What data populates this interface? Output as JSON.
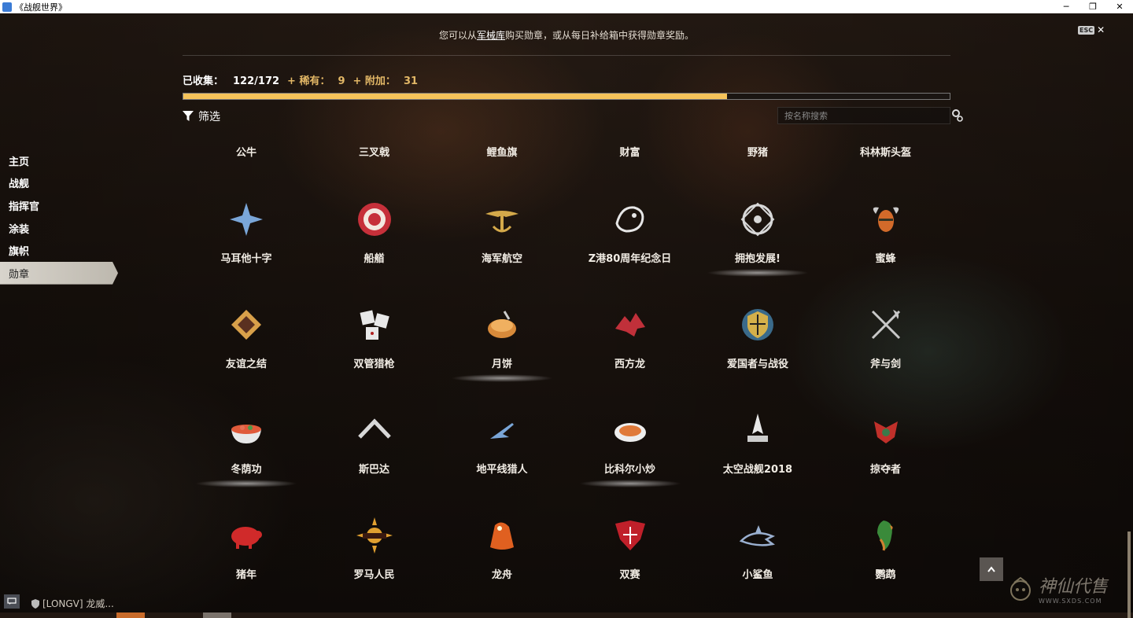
{
  "window": {
    "title": "《战舰世界》",
    "min": "─",
    "restore": "❐",
    "close": "✕"
  },
  "esc": {
    "badge": "ESC",
    "x": "✕"
  },
  "hint": {
    "before": "您可以从",
    "link": "军械库",
    "after": "购买勋章，或从每日补给箱中获得勋章奖励。"
  },
  "stats": {
    "collected_label": "已收集：",
    "collected_value": "122/172",
    "rare_label": "+ 稀有：",
    "rare_value": "9",
    "extra_label": "+ 附加：",
    "extra_value": "31",
    "progress": 0.7094
  },
  "filter": {
    "label": "筛选"
  },
  "search": {
    "placeholder": "按名称搜索"
  },
  "nav": {
    "items": [
      "主页",
      "战舰",
      "指挥官",
      "涂装",
      "旗帜",
      "勋章"
    ],
    "active": "勋章"
  },
  "top_labels": [
    "公牛",
    "三叉戟",
    "鲤鱼旗",
    "财富",
    "野猪",
    "科林斯头盔"
  ],
  "rows": [
    [
      {
        "label": "马耳他十字",
        "icon": "maltese-cross-icon",
        "color": "#7aa6d8"
      },
      {
        "label": "船艏",
        "icon": "target-icon",
        "color": "#c6303a"
      },
      {
        "label": "海军航空",
        "icon": "wings-anchor-icon",
        "color": "#d4a94a"
      },
      {
        "label": "Z港80周年纪念日",
        "icon": "dragon-icon",
        "color": "#e6e6e6"
      },
      {
        "label": "拥抱发展!",
        "icon": "emblem-icon",
        "color": "#d8d8d8",
        "glow": true
      },
      {
        "label": "蜜蜂",
        "icon": "bee-icon",
        "color": "#d26a2a"
      }
    ],
    [
      {
        "label": "友谊之结",
        "icon": "knot-icon",
        "color": "#d8a04a"
      },
      {
        "label": "双管猎枪",
        "icon": "dice-icon",
        "color": "#e8e8e8"
      },
      {
        "label": "月饼",
        "icon": "mooncake-icon",
        "color": "#d88a3a",
        "glow": true
      },
      {
        "label": "西方龙",
        "icon": "western-dragon-icon",
        "color": "#c0303a"
      },
      {
        "label": "爱国者与战役",
        "icon": "shield-icon",
        "color": "#d4b04a"
      },
      {
        "label": "斧与剑",
        "icon": "axe-sword-icon",
        "color": "#c8c8c8"
      }
    ],
    [
      {
        "label": "冬荫功",
        "icon": "soup-icon",
        "color": "#e05a3a",
        "glow": true
      },
      {
        "label": "斯巴达",
        "icon": "chevron-icon",
        "color": "#d8d8d8"
      },
      {
        "label": "地平线猎人",
        "icon": "jet-icon",
        "color": "#7aa6d8"
      },
      {
        "label": "比科尔小炒",
        "icon": "dish-icon",
        "color": "#e07a3a",
        "glow": true
      },
      {
        "label": "太空战舰2018",
        "icon": "space-ship-icon",
        "color": "#e8e8e8"
      },
      {
        "label": "掠夺者",
        "icon": "raider-icon",
        "color": "#c0302a"
      }
    ],
    [
      {
        "label": "猪年",
        "icon": "pig-icon",
        "color": "#d02a2a"
      },
      {
        "label": "罗马人民",
        "icon": "sun-icon",
        "color": "#e0a030"
      },
      {
        "label": "龙舟",
        "icon": "dragon-boat-icon",
        "color": "#e06020"
      },
      {
        "label": "双赛",
        "icon": "crest-icon",
        "color": "#c0202a"
      },
      {
        "label": "小鲨鱼",
        "icon": "shark-icon",
        "color": "#9ab0d0"
      },
      {
        "label": "鹦鹉",
        "icon": "parrot-icon",
        "color": "#d08030"
      }
    ]
  ],
  "chat": {
    "text": "[LONGV] 龙威..."
  },
  "watermark": {
    "brand": "神仙代售",
    "site": "WWW.SXDS.COM"
  }
}
